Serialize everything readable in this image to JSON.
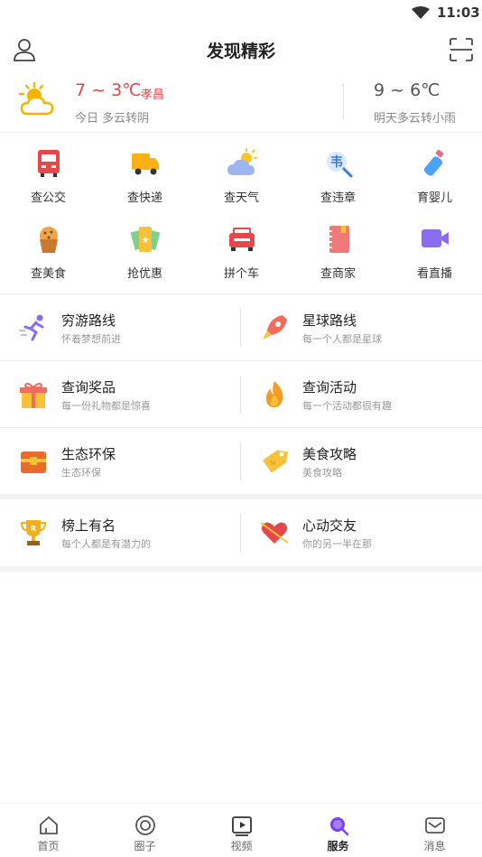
{
  "status_bar": {
    "time": "11:03"
  },
  "header": {
    "title": "发现精彩"
  },
  "weather": {
    "today_temp": "7 ~ 3℃",
    "city": "孝昌",
    "today_desc": "今日 多云转阴",
    "tomorrow_temp": "9 ~ 6℃",
    "tomorrow_desc": "明天多云转小雨"
  },
  "grid": [
    {
      "label": "查公交",
      "icon": "bus-icon"
    },
    {
      "label": "查快递",
      "icon": "truck-icon"
    },
    {
      "label": "查天气",
      "icon": "weather-icon"
    },
    {
      "label": "查违章",
      "icon": "violation-icon"
    },
    {
      "label": "育婴儿",
      "icon": "baby-bottle-icon"
    },
    {
      "label": "查美食",
      "icon": "muffin-icon"
    },
    {
      "label": "抢优惠",
      "icon": "coupon-icon"
    },
    {
      "label": "拼个车",
      "icon": "car-icon"
    },
    {
      "label": "查商家",
      "icon": "notebook-icon"
    },
    {
      "label": "看直播",
      "icon": "video-camera-icon"
    }
  ],
  "cards": [
    {
      "title": "穷游路线",
      "sub": "怀着梦想前进",
      "icon": "runner-icon"
    },
    {
      "title": "星球路线",
      "sub": "每一个人都是星球",
      "icon": "rocket-icon"
    },
    {
      "title": "查询奖品",
      "sub": "每一份礼物都是惊喜",
      "icon": "gift-icon"
    },
    {
      "title": "查询活动",
      "sub": "每一个活动都很有趣",
      "icon": "flame-icon"
    },
    {
      "title": "生态环保",
      "sub": "生态环保",
      "icon": "treasure-chest-icon"
    },
    {
      "title": "美食攻略",
      "sub": "美食攻略",
      "icon": "tag-icon"
    },
    {
      "title": "榜上有名",
      "sub": "每个人都是有潜力的",
      "icon": "trophy-icon"
    },
    {
      "title": "心动交友",
      "sub": "你的另一半在那",
      "icon": "heart-arrow-icon"
    }
  ],
  "bottom_nav": [
    {
      "label": "首页",
      "icon": "home-icon"
    },
    {
      "label": "圈子",
      "icon": "circle-icon"
    },
    {
      "label": "视频",
      "icon": "play-icon"
    },
    {
      "label": "服务",
      "icon": "service-search-icon",
      "active": true
    },
    {
      "label": "消息",
      "icon": "mail-icon"
    }
  ],
  "colors": {
    "accent_red": "#e54545",
    "active_nav": "#7a3ff2"
  }
}
